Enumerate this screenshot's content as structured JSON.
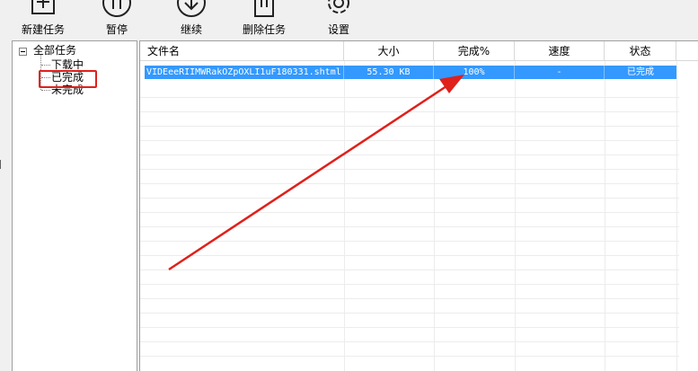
{
  "toolbar": {
    "new_task": "新建任务",
    "pause": "暂停",
    "resume": "继续",
    "delete": "删除任务",
    "settings": "设置"
  },
  "tree": {
    "root": "全部任务",
    "downloading": "下载中",
    "completed": "已完成",
    "incomplete": "未完成"
  },
  "table": {
    "columns": [
      "文件名",
      "大小",
      "完成%",
      "速度",
      "状态"
    ],
    "rows": [
      {
        "filename": "VIDEeeRIIMWRakOZpOXLI1uF180331.shtml",
        "size": "55.30 KB",
        "progress": "100%",
        "speed": "-",
        "status": "已完成"
      }
    ]
  },
  "colors": {
    "selection": "#3399ff",
    "annotation": "#e0201b"
  }
}
